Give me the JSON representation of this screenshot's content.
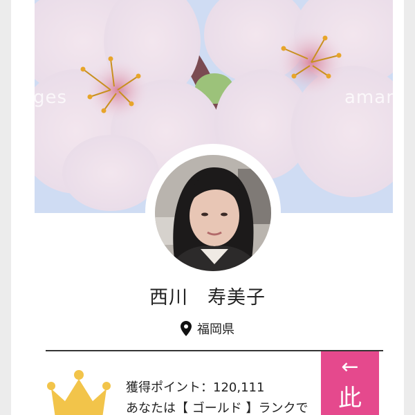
{
  "profile": {
    "name": "西川　寿美子",
    "location": "福岡県"
  },
  "cover": {
    "watermark_left": "ges",
    "watermark_right": "aman"
  },
  "rewards": {
    "points_text": "獲得ポイント：120,111",
    "rank_text": "あなたは【 ゴールド 】ランクで"
  },
  "cta": {
    "arrow": "←",
    "label": "此"
  },
  "icons": {
    "location": "map-pin-icon",
    "rank": "crown-icon"
  },
  "colors": {
    "accent": "#e5498d",
    "crown": "#f2c44a",
    "divider": "#333333"
  }
}
